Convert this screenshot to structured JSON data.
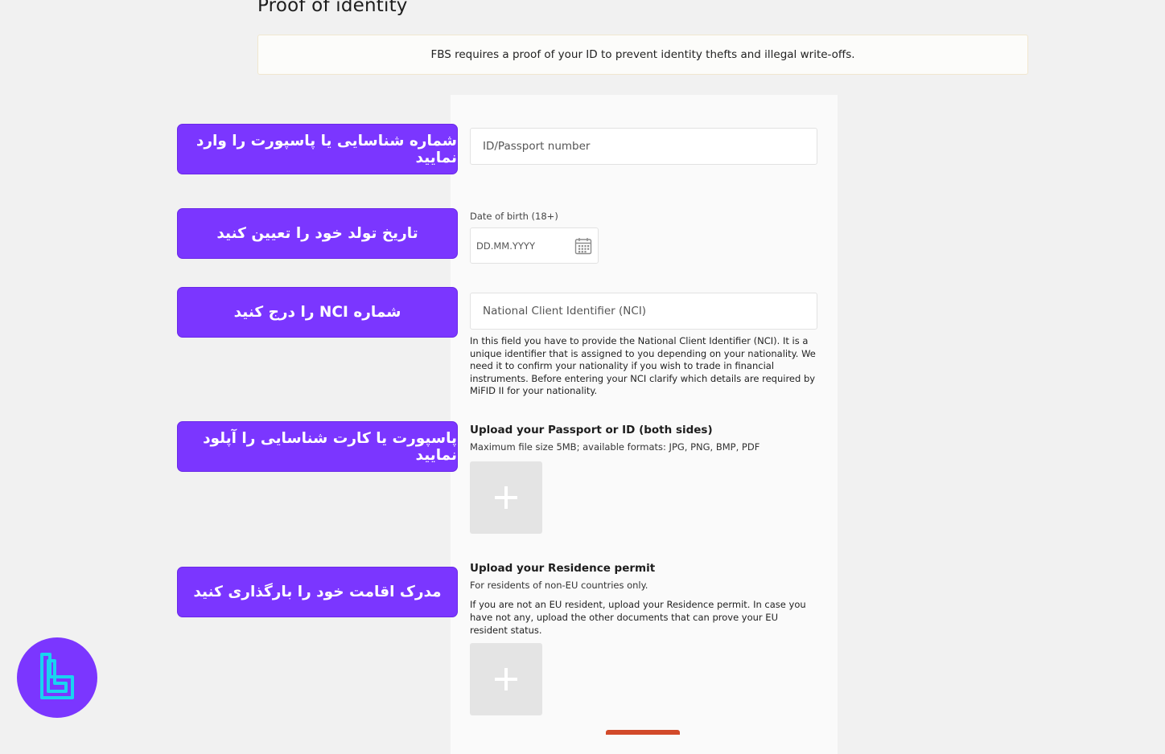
{
  "page": {
    "title": "Proof of identity",
    "notice": "FBS requires a proof of your ID to prevent identity thefts and illegal write-offs."
  },
  "form": {
    "id_placeholder": "ID/Passport number",
    "dob_label": "Date of birth (18+)",
    "dob_placeholder": "DD.MM.YYYY",
    "nci_placeholder": "National Client Identifier (NCI)",
    "nci_help": "In this field you have to provide the National Client Identifier (NCI). It is a unique identifier that is assigned to you depending on your nationality. We need it to confirm your nationality if you wish to trade in financial instruments. Before entering your NCI clarify which details are required by MiFID II for your nationality.",
    "passport_upload": {
      "title": "Upload your Passport or ID (both sides)",
      "subtitle": "Maximum file size 5MB; available formats: JPG, PNG, BMP, PDF"
    },
    "residence_upload": {
      "title": "Upload your Residence permit",
      "subtitle": "For residents of non-EU countries only.",
      "description": "If you are not an EU resident, upload your Residence permit. In case you have not any, upload the other documents that can prove your EU resident status."
    }
  },
  "callouts": [
    "شماره شناسایی یا پاسپورت را وارد نمایید",
    "تاریخ  تولد خود را تعیین کنید",
    "شماره NCI را درج کنید",
    "پاسپورت یا کارت شناسایی را آپلود نمایید",
    "مدرک اقامت خود را بارگذاری کنید"
  ],
  "colors": {
    "callout_bg": "#7b36ff",
    "page_bg": "#f1f1f1",
    "upload_tile": "#e4e4e4",
    "logo_accent": "#19d3f0"
  },
  "icons": {
    "calendar": "calendar-icon",
    "upload": "plus-icon",
    "logo": "tradingfinder-logo"
  }
}
